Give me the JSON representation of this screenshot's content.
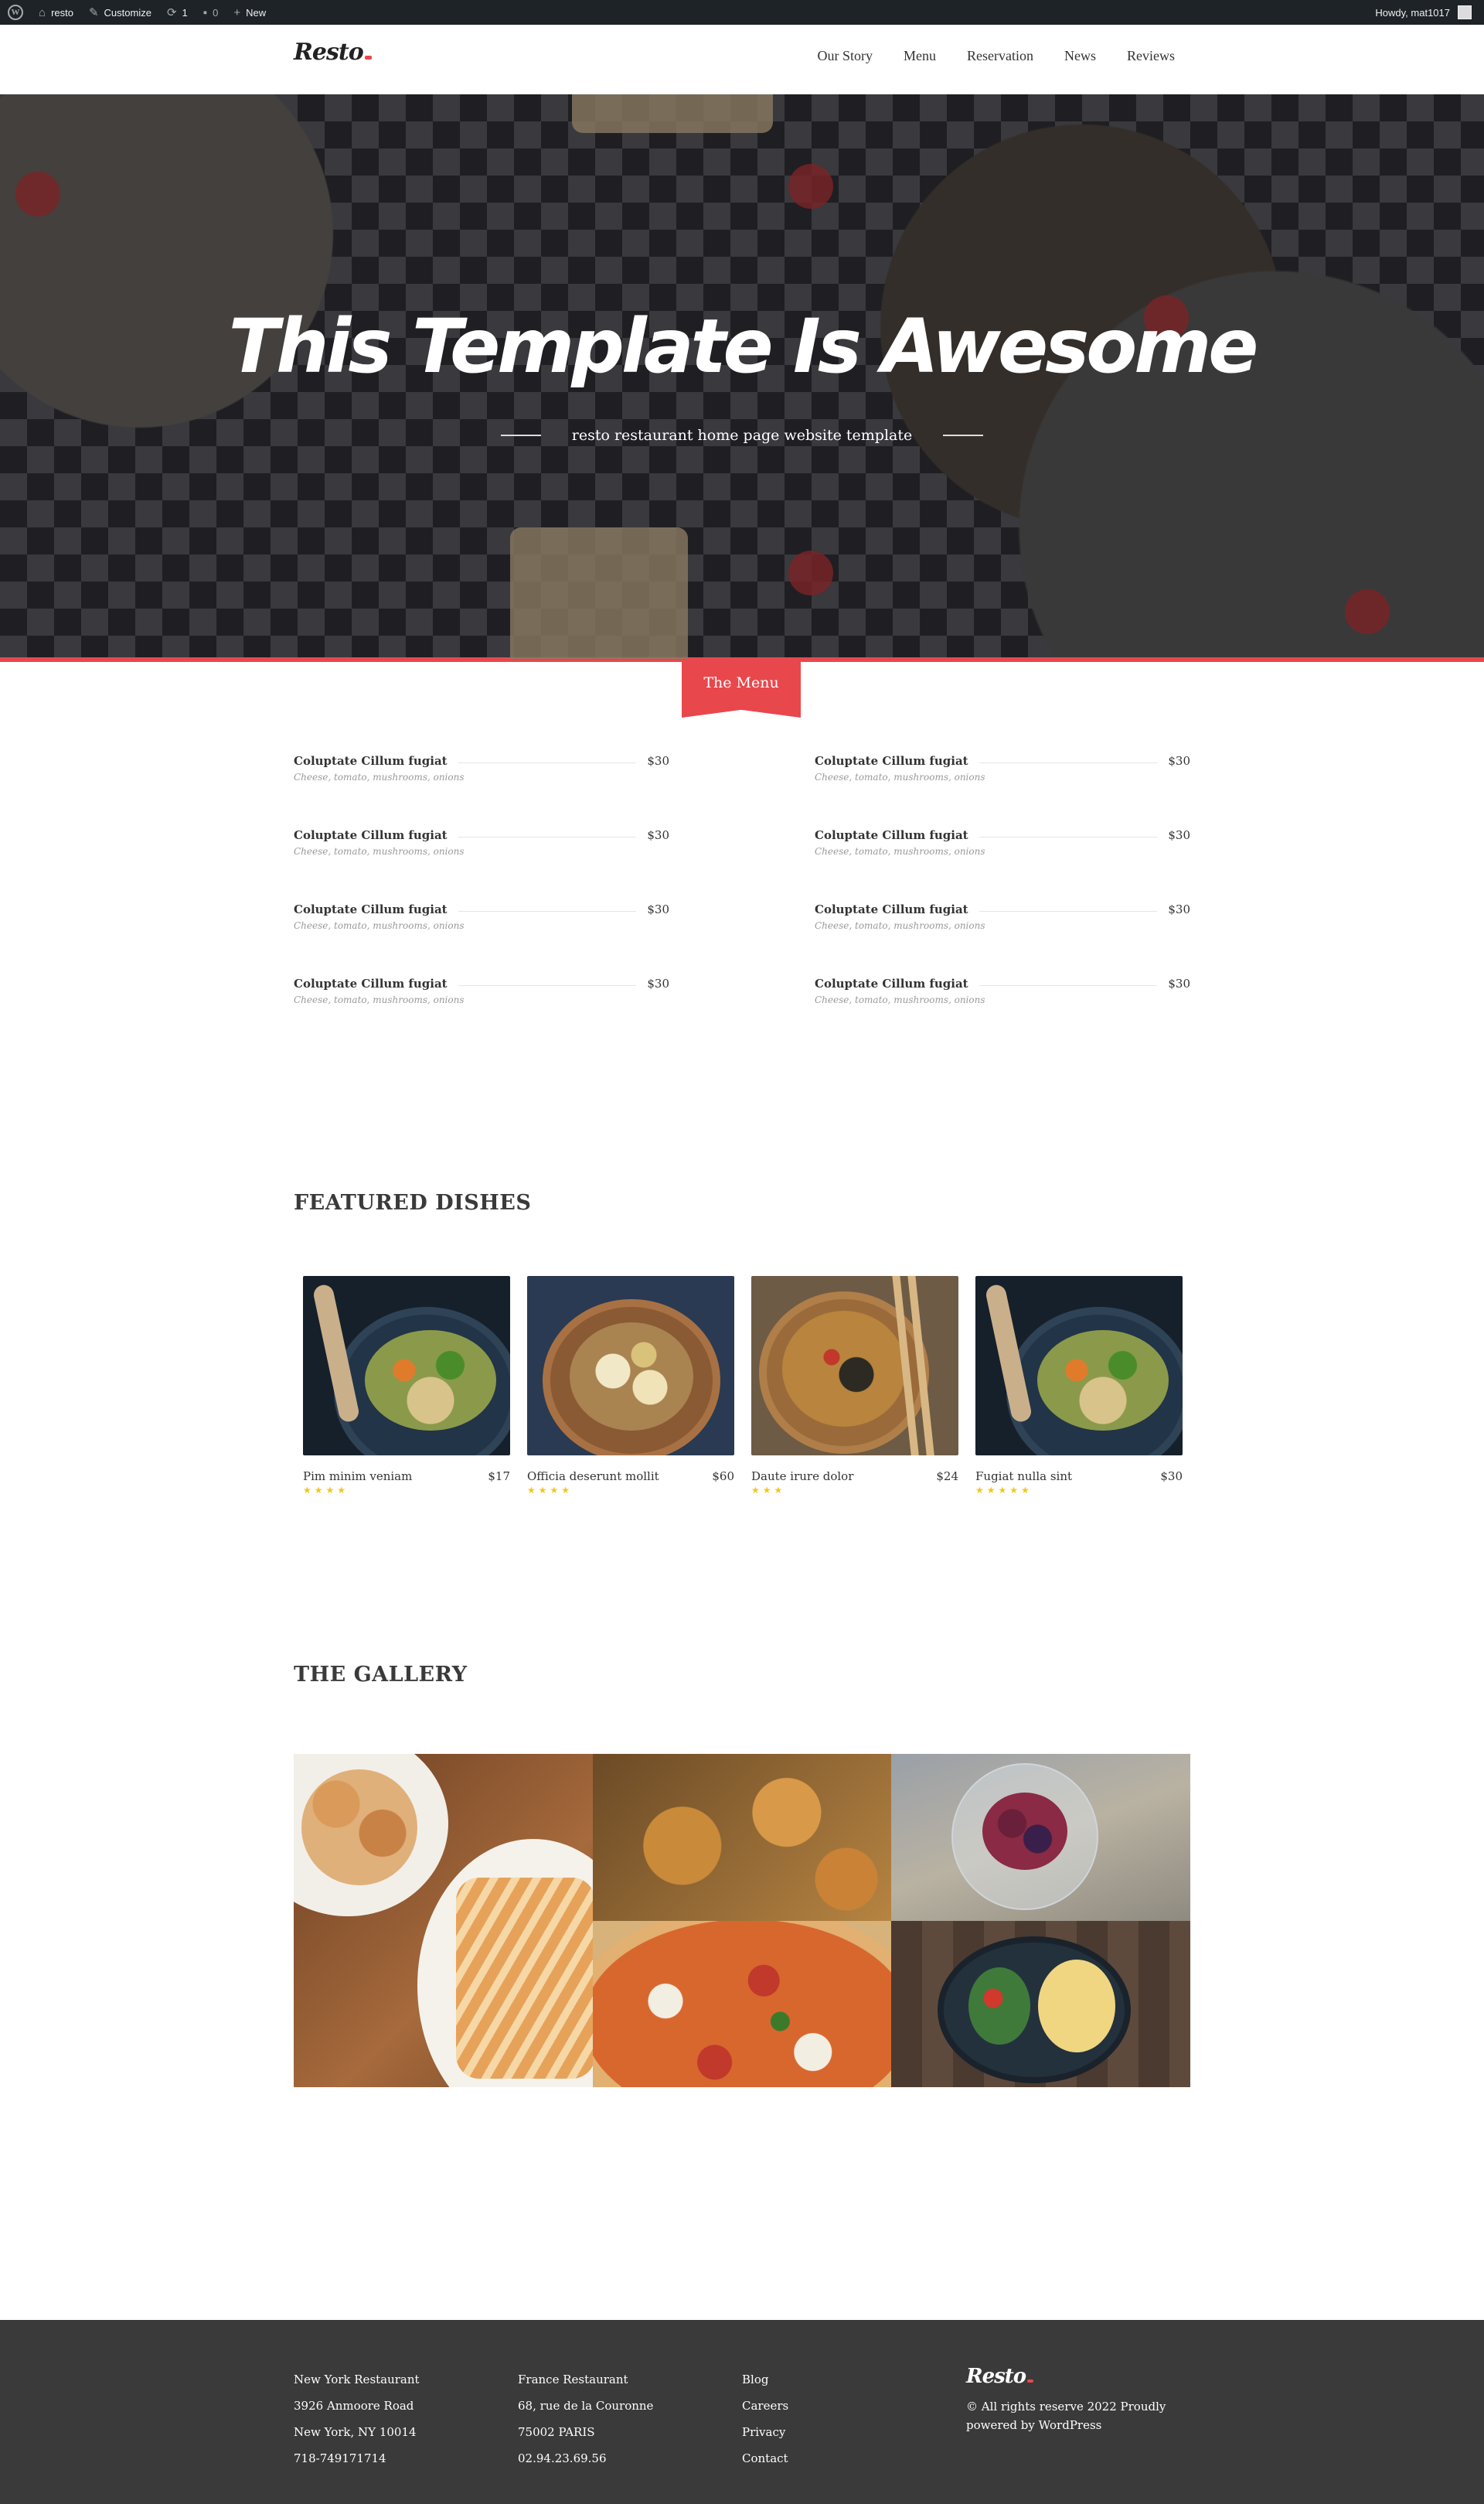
{
  "adminbar": {
    "site_name": "resto",
    "customize": "Customize",
    "updates_count": "1",
    "comments_count": "0",
    "new_label": "New",
    "howdy": "Howdy, mat1017"
  },
  "header": {
    "logo": "Resto",
    "nav": [
      "Our Story",
      "Menu",
      "Reservation",
      "News",
      "Reviews"
    ]
  },
  "hero": {
    "title": "This Template Is Awesome",
    "subtitle": "resto restaurant home page website template"
  },
  "menu": {
    "tab_label": "The Menu",
    "items": [
      {
        "name": "Coluptate Cillum fugiat",
        "price": "$30",
        "desc": "Cheese, tomato, mushrooms, onions"
      },
      {
        "name": "Coluptate Cillum fugiat",
        "price": "$30",
        "desc": "Cheese, tomato, mushrooms, onions"
      },
      {
        "name": "Coluptate Cillum fugiat",
        "price": "$30",
        "desc": "Cheese, tomato, mushrooms, onions"
      },
      {
        "name": "Coluptate Cillum fugiat",
        "price": "$30",
        "desc": "Cheese, tomato, mushrooms, onions"
      },
      {
        "name": "Coluptate Cillum fugiat",
        "price": "$30",
        "desc": "Cheese, tomato, mushrooms, onions"
      },
      {
        "name": "Coluptate Cillum fugiat",
        "price": "$30",
        "desc": "Cheese, tomato, mushrooms, onions"
      },
      {
        "name": "Coluptate Cillum fugiat",
        "price": "$30",
        "desc": "Cheese, tomato, mushrooms, onions"
      },
      {
        "name": "Coluptate Cillum fugiat",
        "price": "$30",
        "desc": "Cheese, tomato, mushrooms, onions"
      }
    ]
  },
  "featured": {
    "title": "FEATURED DISHES",
    "dishes": [
      {
        "name": "Pim minim veniam",
        "price": "$17",
        "stars": "★★★★",
        "rating": 4
      },
      {
        "name": "Officia deserunt mollit",
        "price": "$60",
        "stars": "★★★★",
        "rating": 4
      },
      {
        "name": "Daute irure dolor",
        "price": "$24",
        "stars": "★★★",
        "rating": 3
      },
      {
        "name": "Fugiat nulla sint",
        "price": "$30",
        "stars": "★★★★★",
        "rating": 5
      }
    ]
  },
  "gallery": {
    "title": "THE GALLERY"
  },
  "footer": {
    "col1": [
      "New York Restaurant",
      "3926 Anmoore Road",
      "New York, NY 10014",
      "718-749171714"
    ],
    "col2": [
      "France Restaurant",
      "68, rue de la Couronne",
      "75002 PARIS",
      "02.94.23.69.56"
    ],
    "col3": [
      "Blog",
      "Careers",
      "Privacy",
      "Contact"
    ],
    "logo": "Resto",
    "copyright": "© All rights reserve 2022 Proudly powered by WordPress"
  },
  "colors": {
    "accent": "#e8474c",
    "adminbar": "#1d2327",
    "footer": "#3a3a3a",
    "star": "#f5c518"
  }
}
